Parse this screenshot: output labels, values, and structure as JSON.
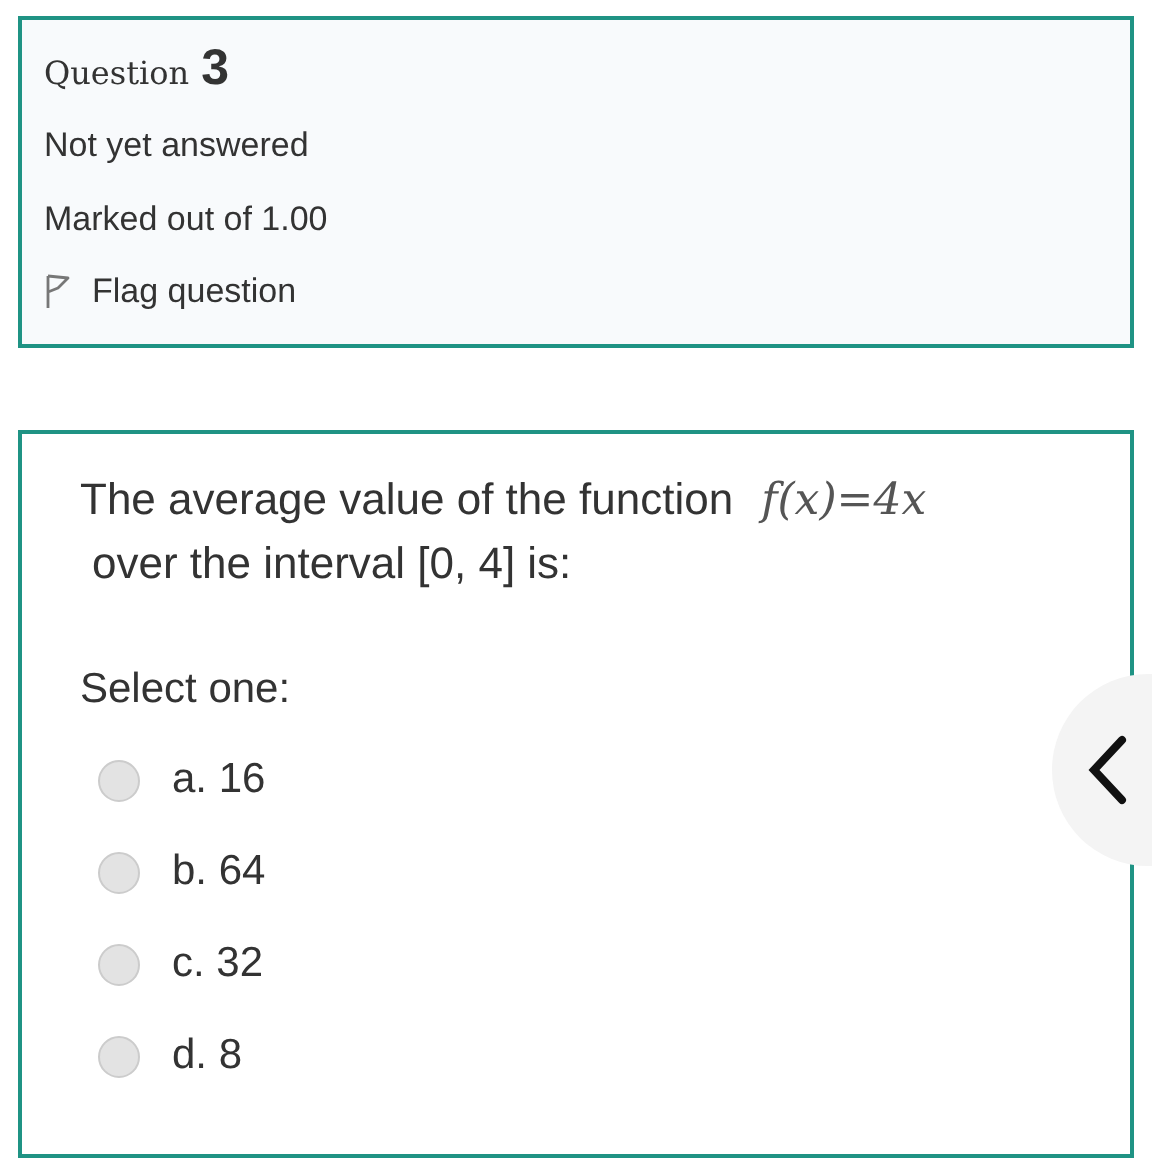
{
  "info": {
    "label": "Question",
    "number": "3",
    "state": "Not yet answered",
    "marks": "Marked out of 1.00",
    "flag": {
      "label": "Flag question",
      "flagged": false
    }
  },
  "question": {
    "text": "The average value of the function",
    "formula": "f(x)=4x",
    "text_continued": "over the interval [0, 4] is:",
    "prompt": "Select one:",
    "options": [
      {
        "label": "a. 16",
        "selected": false
      },
      {
        "label": "b. 64",
        "selected": false
      },
      {
        "label": "c. 32",
        "selected": false
      },
      {
        "label": "d. 8",
        "selected": false
      }
    ]
  }
}
